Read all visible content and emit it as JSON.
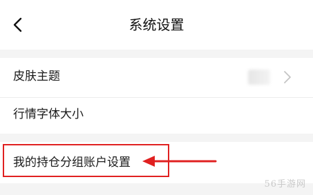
{
  "header": {
    "title": "系统设置",
    "back_icon": "chevron-left-icon"
  },
  "settings": {
    "items": [
      {
        "label": "皮肤主题",
        "trailing_icon": "chevron-right-icon"
      },
      {
        "label": "行情字体大小"
      },
      {
        "label": "我的持仓分组账户设置"
      }
    ]
  },
  "annotation": {
    "color": "#e02020"
  },
  "watermark": {
    "text": "56手游网"
  }
}
